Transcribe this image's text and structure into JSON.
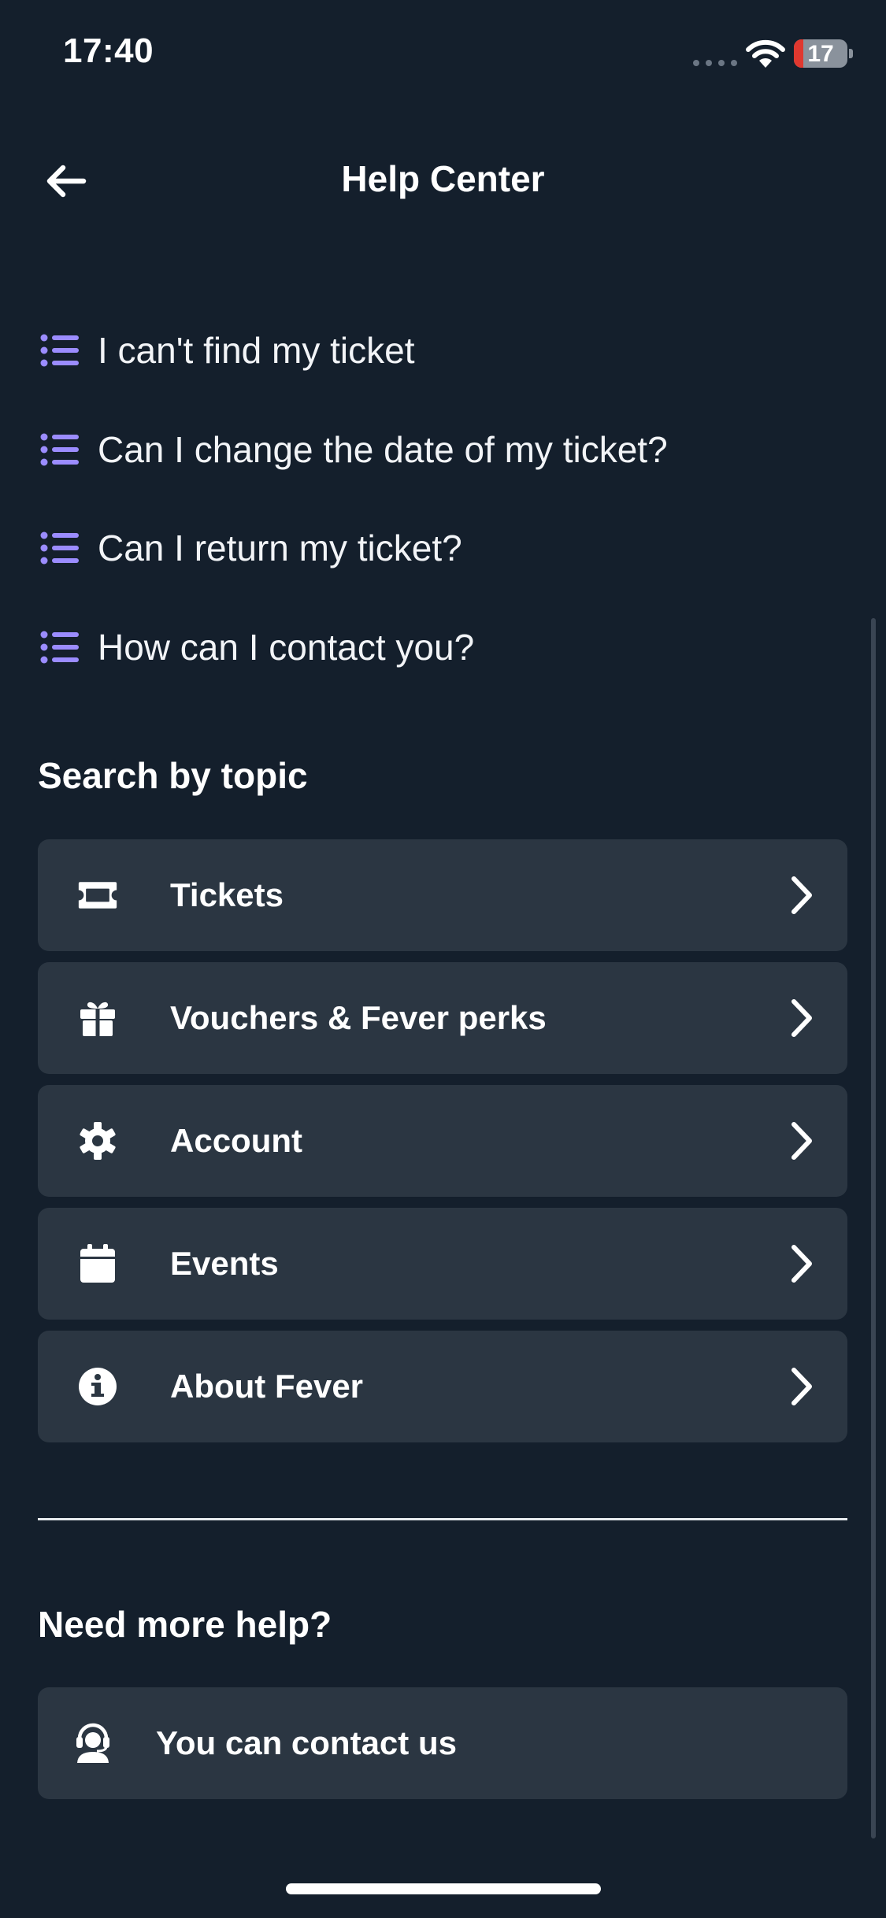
{
  "status_bar": {
    "time": "17:40",
    "battery": "17",
    "battery_level": 0.17
  },
  "header": {
    "title": "Help Center",
    "back_icon": "arrow-left-icon"
  },
  "faq": [
    {
      "question": "I can't find my ticket",
      "icon": "list-icon"
    },
    {
      "question": "Can I change the date of my ticket?",
      "icon": "list-icon"
    },
    {
      "question": "Can I return my ticket?",
      "icon": "list-icon"
    },
    {
      "question": "How can I contact you?",
      "icon": "list-icon"
    }
  ],
  "topics_section": {
    "title": "Search by topic",
    "items": [
      {
        "label": "Tickets",
        "icon": "ticket-icon"
      },
      {
        "label": "Vouchers & Fever perks",
        "icon": "gift-icon"
      },
      {
        "label": "Account",
        "icon": "gear-icon"
      },
      {
        "label": "Events",
        "icon": "calendar-icon"
      },
      {
        "label": "About Fever",
        "icon": "info-icon"
      }
    ]
  },
  "help_section": {
    "title": "Need more help?",
    "contact_label": "You can contact us",
    "contact_icon": "support-agent-icon"
  },
  "colors": {
    "background": "#141f2c",
    "card": "#2b3642",
    "accent": "#9b8cff",
    "text": "#ffffff"
  }
}
